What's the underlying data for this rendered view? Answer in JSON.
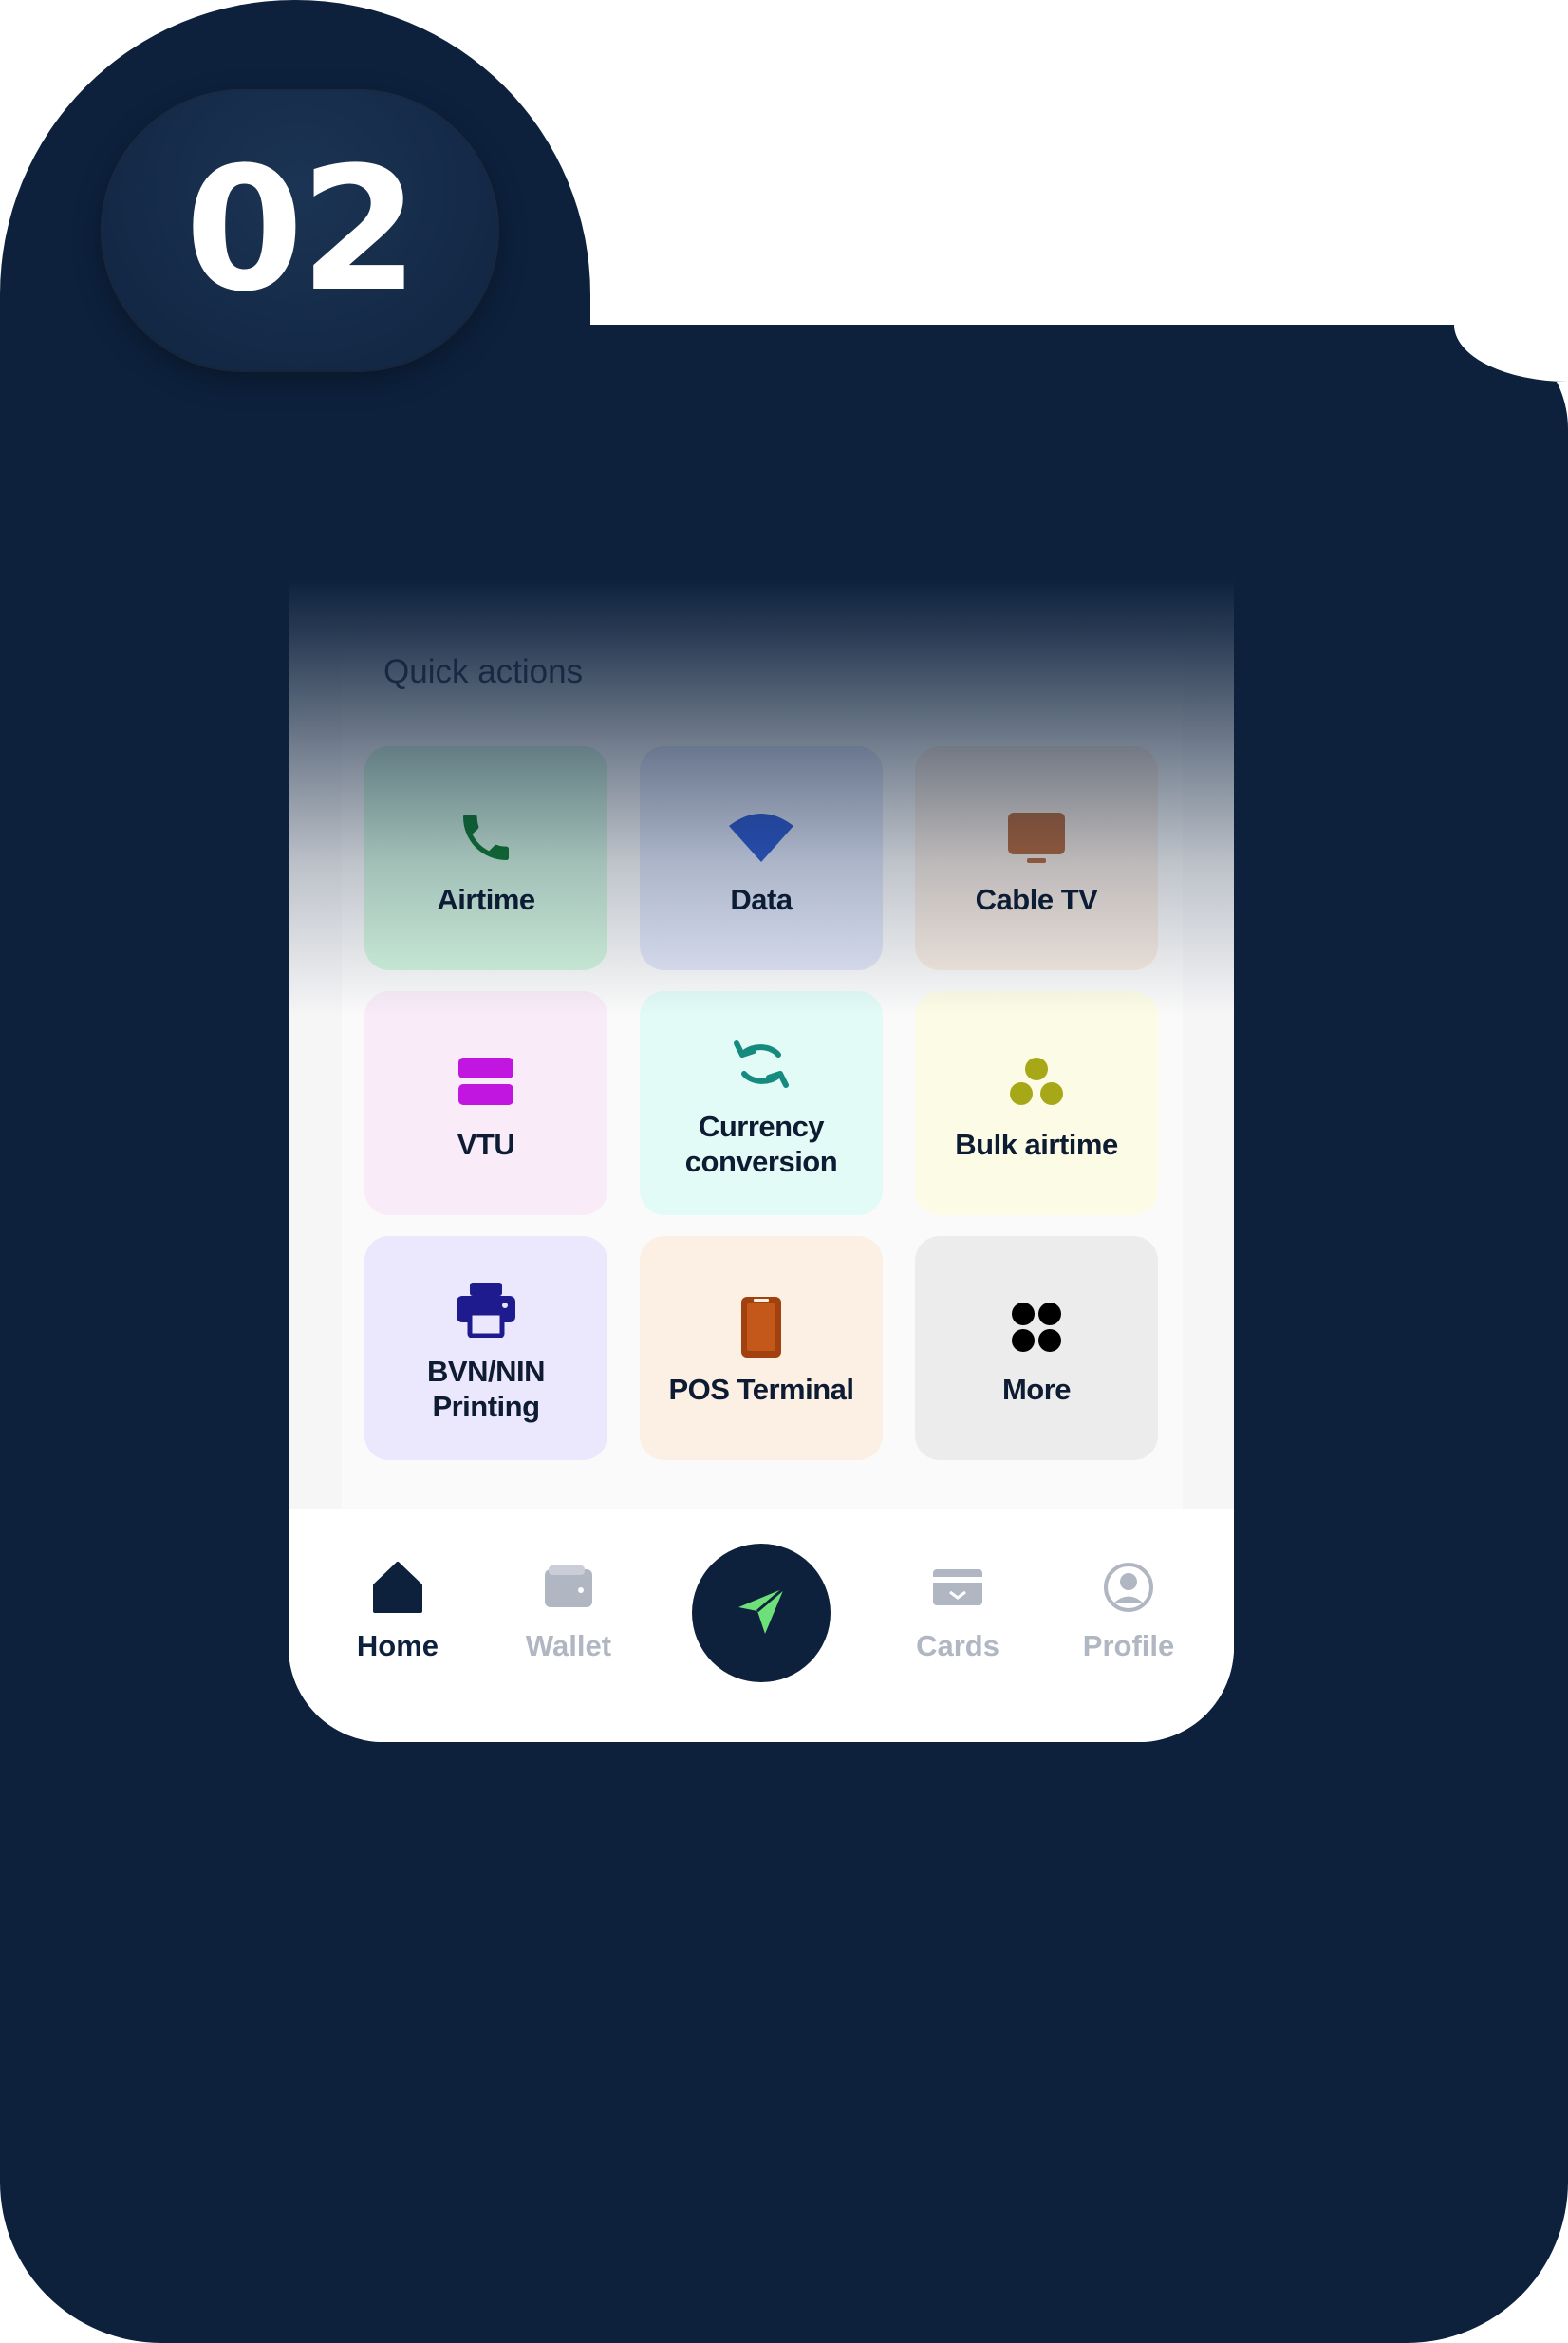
{
  "step": {
    "number": "02"
  },
  "quick_actions": {
    "title": "Quick actions",
    "tiles": [
      {
        "label": "Airtime",
        "icon": "phone-icon",
        "bg": "#d4f5e0",
        "color": "#0f7a2f"
      },
      {
        "label": "Data",
        "icon": "wifi-icon",
        "bg": "#e2e7f8",
        "color": "#2f5bd0"
      },
      {
        "label": "Cable TV",
        "icon": "tv-icon",
        "bg": "#f8ece3",
        "color": "#b86a3c"
      },
      {
        "label": "VTU",
        "icon": "vtu-icon",
        "bg": "#f9ecf8",
        "color": "#c115e0"
      },
      {
        "label": "Currency conversion",
        "icon": "exchange-icon",
        "bg": "#e3fbf7",
        "color": "#158a7f"
      },
      {
        "label": "Bulk airtime",
        "icon": "group-dots-icon",
        "bg": "#fcfce6",
        "color": "#a7a818"
      },
      {
        "label": "BVN/NIN Printing",
        "icon": "printer-icon",
        "bg": "#ebe7fc",
        "color": "#1e1b8f"
      },
      {
        "label": "POS Terminal",
        "icon": "pos-device-icon",
        "bg": "#fcefe3",
        "color": "#a0410f"
      },
      {
        "label": "More",
        "icon": "grid-dots-icon",
        "bg": "#ececec",
        "color": "#000000"
      }
    ]
  },
  "nav": {
    "items": [
      {
        "label": "Home",
        "icon": "home-icon",
        "active": true
      },
      {
        "label": "Wallet",
        "icon": "wallet-icon",
        "active": false
      },
      {
        "label": "Cards",
        "icon": "card-icon",
        "active": false
      },
      {
        "label": "Profile",
        "icon": "profile-icon",
        "active": false
      }
    ],
    "center_button": {
      "icon": "send-icon",
      "color": "#6ee07a"
    }
  }
}
